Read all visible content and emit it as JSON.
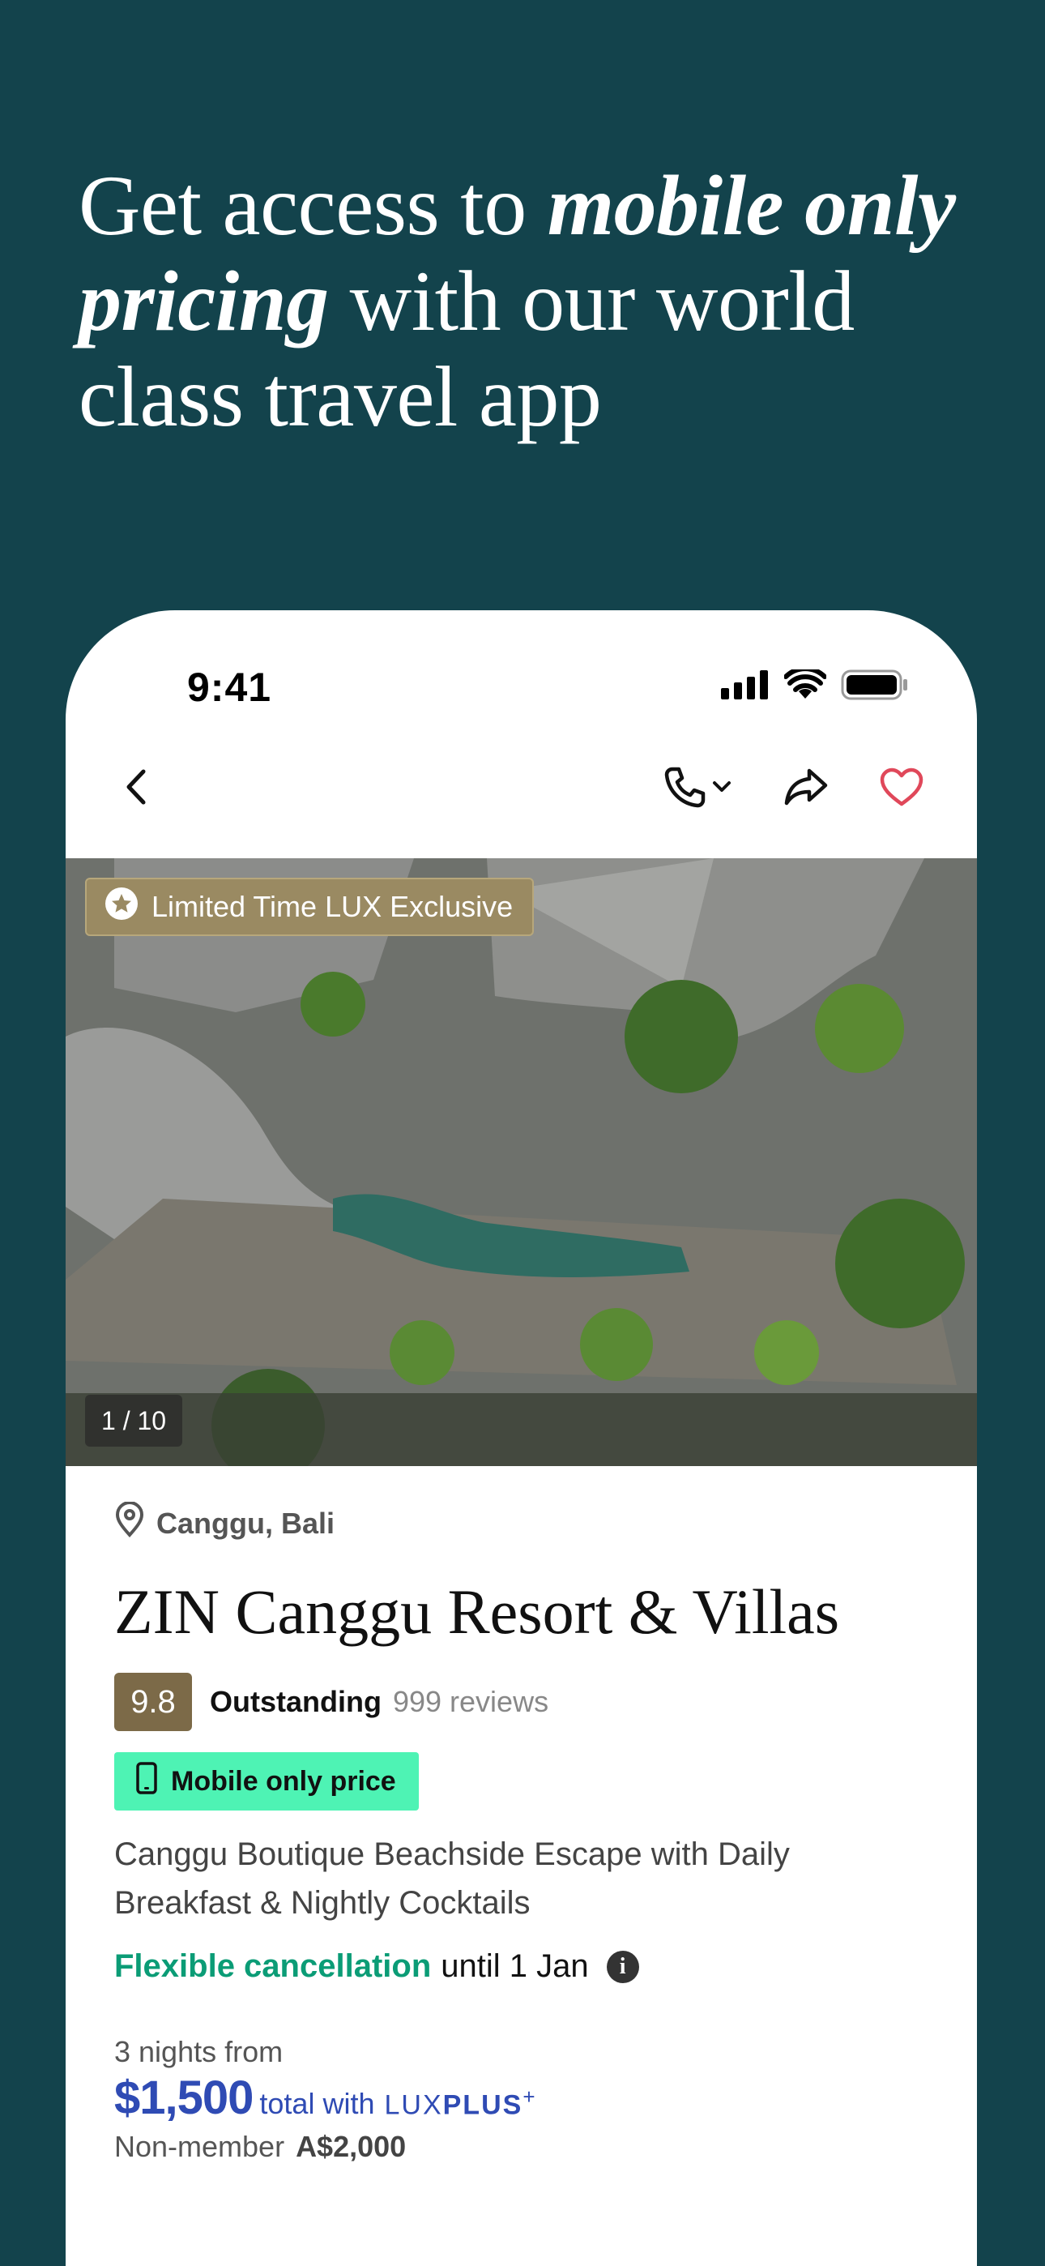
{
  "headline": {
    "part1": "Get access to ",
    "part2_em": "mobile only pricing",
    "part3": " with our world class travel app"
  },
  "status_bar": {
    "time": "9:41"
  },
  "hero": {
    "exclusive_badge": "Limited Time LUX Exclusive",
    "image_counter": "1 / 10"
  },
  "listing": {
    "location": "Canggu, Bali",
    "title": "ZIN Canggu Resort & Villas",
    "score": "9.8",
    "rating_label": "Outstanding",
    "reviews": "999 reviews",
    "mobile_badge": "Mobile only price",
    "description": "Canggu Boutique Beachside Escape with Daily Breakfast & Nightly Cocktails",
    "cancellation_highlight": "Flexible cancellation",
    "cancellation_rest": "until 1 Jan",
    "nights_label": "3 nights from",
    "price": "$1,500",
    "total_with": "total with",
    "lux_prefix": "LUX",
    "lux_plus": "PLUS",
    "lux_sup": "+",
    "nonmember_label": "Non-member",
    "nonmember_price": "A$2,000"
  },
  "colors": {
    "background": "#13434c",
    "badge_gold": "#9a8a62",
    "mobile_badge": "#4ef3b4",
    "price_blue": "#2f4bb4",
    "cancel_green": "#0b9c76",
    "heart_red": "#e0485a"
  },
  "icons": [
    "back-chevron-icon",
    "phone-icon",
    "chevron-down-icon",
    "share-icon",
    "heart-icon",
    "star-icon",
    "location-pin-icon",
    "mobile-device-icon",
    "info-icon",
    "signal-icon",
    "wifi-icon",
    "battery-icon"
  ]
}
